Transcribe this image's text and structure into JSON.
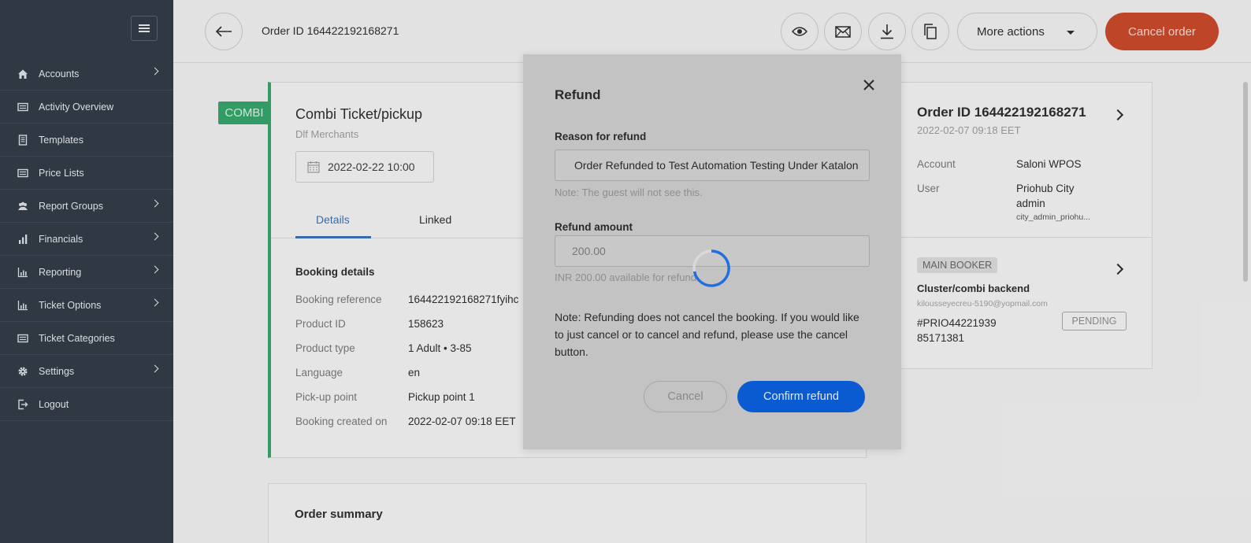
{
  "sidebar": {
    "items": [
      {
        "label": "Accounts",
        "icon": "home-icon",
        "has_submenu": true
      },
      {
        "label": "Activity Overview",
        "icon": "list-icon",
        "has_submenu": false
      },
      {
        "label": "Templates",
        "icon": "document-icon",
        "has_submenu": false
      },
      {
        "label": "Price Lists",
        "icon": "list-icon",
        "has_submenu": false
      },
      {
        "label": "Report Groups",
        "icon": "users-icon",
        "has_submenu": true
      },
      {
        "label": "Financials",
        "icon": "bar-chart-icon",
        "has_submenu": true
      },
      {
        "label": "Reporting",
        "icon": "chart-icon",
        "has_submenu": true
      },
      {
        "label": "Ticket Options",
        "icon": "chart-icon",
        "has_submenu": true
      },
      {
        "label": "Ticket Categories",
        "icon": "list-icon",
        "has_submenu": false
      },
      {
        "label": "Settings",
        "icon": "gear-icon",
        "has_submenu": true
      },
      {
        "label": "Logout",
        "icon": "logout-icon",
        "has_submenu": false
      }
    ]
  },
  "header": {
    "order_id": "Order ID 164422192168271",
    "more_actions_label": "More actions",
    "cancel_order_label": "Cancel order"
  },
  "product": {
    "badge": "COMBI",
    "title": "Combi Ticket/pickup",
    "merchant": "Dlf Merchants",
    "date": "2022-02-22 10:00",
    "tabs": [
      "Details",
      "Linked"
    ],
    "section_title": "Booking details",
    "details": [
      {
        "key": "Booking reference",
        "value": "164422192168271fyihc"
      },
      {
        "key": "Product ID",
        "value": "158623"
      },
      {
        "key": "Product type",
        "value": "1 Adult • 3-85"
      },
      {
        "key": "Language",
        "value": "en"
      },
      {
        "key": "Pick-up point",
        "value": "Pickup point 1"
      },
      {
        "key": "Booking created on",
        "value": "2022-02-07 09:18 EET"
      }
    ],
    "summary_title": "Order summary"
  },
  "right_panel": {
    "order_id": "Order ID 164422192168271",
    "created": "2022-02-07 09:18 EET",
    "account_label": "Account",
    "account_value": "Saloni WPOS",
    "user_label": "User",
    "user_line1": "Priohub City",
    "user_line2": "admin",
    "user_line3": "city_admin_priohu...",
    "main_booker_badge": "MAIN BOOKER",
    "booker_name": "Cluster/combi backend",
    "booker_email": "kilousseyecreu-5190@yopmail.com",
    "booking_line1": "#PRIO44221939",
    "booking_line2": "85171381",
    "status": "PENDING"
  },
  "modal": {
    "title": "Refund",
    "reason_label": "Reason for refund",
    "reason_value": "Order Refunded to Test Automation Testing Under Katalon",
    "reason_note": "Note: The guest will not see this.",
    "amount_label": "Refund amount",
    "amount_value": "200.00",
    "amount_note": "INR 200.00 available for refund",
    "note": "Note: Refunding does not cancel the booking. If you would like to just cancel or to cancel and refund, please use the cancel button.",
    "cancel_label": "Cancel",
    "confirm_label": "Confirm refund"
  },
  "colors": {
    "sidebar_bg": "#333b47",
    "combi_green": "#35a469",
    "cancel_order_red": "#c8492a",
    "confirm_blue": "#0a5bd1",
    "active_tab_blue": "#3a6fb5"
  }
}
